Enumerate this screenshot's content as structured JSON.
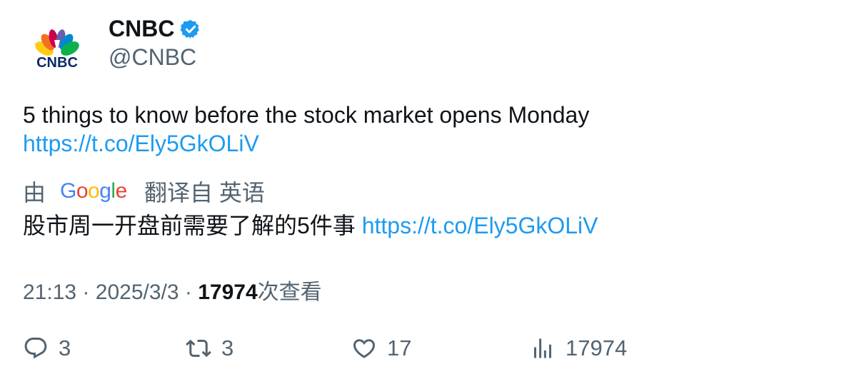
{
  "account": {
    "logo_text": "CNBC",
    "display_name": "CNBC",
    "handle": "@CNBC",
    "verified_icon": "verified-badge-icon"
  },
  "tweet": {
    "text": "5 things to know before the stock market opens Monday",
    "link": "https://t.co/Ely5GkOLiV"
  },
  "translation": {
    "prefix": "由",
    "provider": "Google",
    "suffix": "翻译自 英语",
    "text": "股市周一开盘前需要了解的5件事",
    "link": "https://t.co/Ely5GkOLiV"
  },
  "meta": {
    "time": "21:13",
    "separator": "·",
    "date": "2025/3/3",
    "views": "17974",
    "views_label": "次查看"
  },
  "actions": {
    "replies": "3",
    "retweets": "3",
    "likes": "17",
    "views": "17974"
  },
  "colors": {
    "link": "#1d9bf0",
    "secondary_text": "#536471",
    "primary_text": "#0f1419"
  }
}
